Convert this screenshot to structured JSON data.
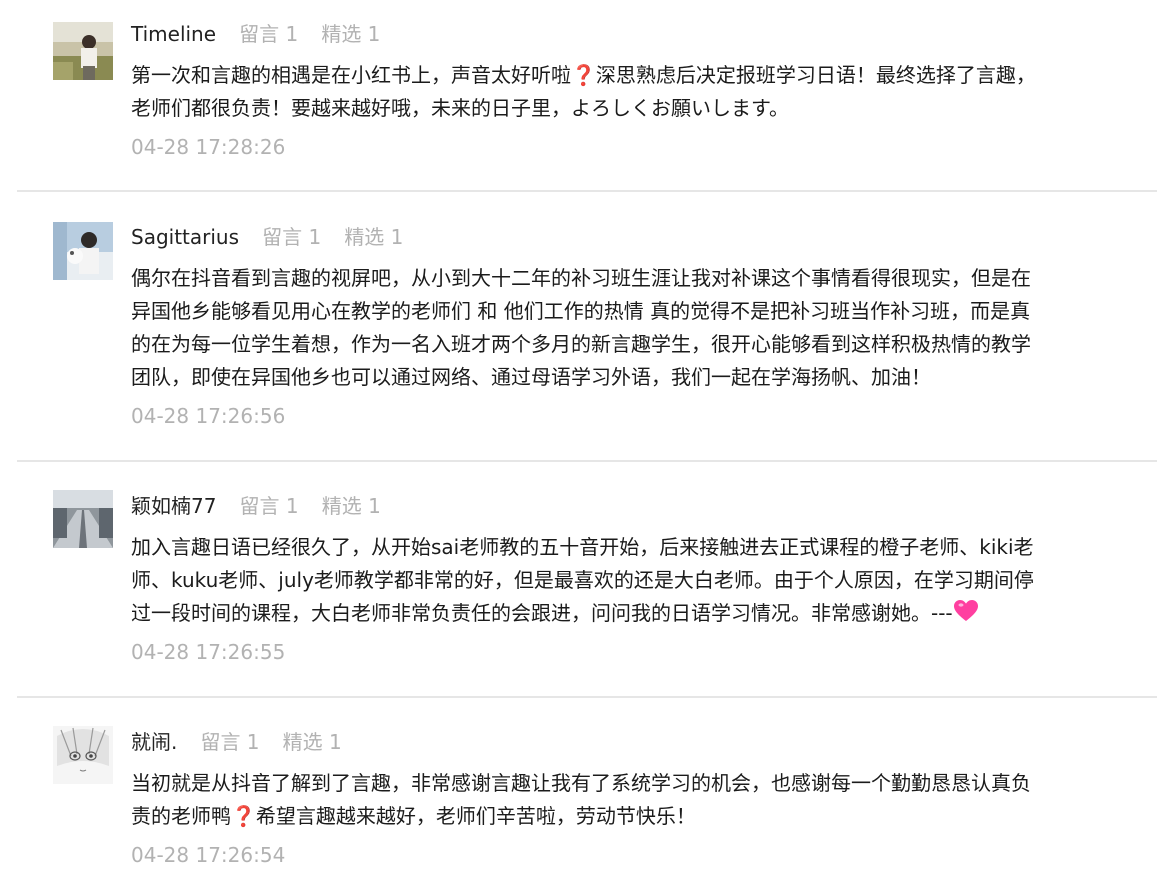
{
  "comments": [
    {
      "nickname": "Timeline",
      "replies_label": "留言 1",
      "featured_label": "精选 1",
      "lines": [
        "第一次和言趣的相遇是在小红书上，声音太好听啦❓深思熟虑后决定报班学习日语！最终选择了言趣，",
        "老师们都很负责！要越来越好哦，未来的日子里，よろしくお願いします。"
      ],
      "time": "04-28 17:28:26"
    },
    {
      "nickname": "Sagittarius",
      "replies_label": "留言 1",
      "featured_label": "精选 1",
      "lines": [
        "偶尔在抖音看到言趣的视屏吧，从小到大十二年的补习班生涯让我对补课这个事情看得很现实，但是在",
        "异国他乡能够看见用心在教学的老师们 和 他们工作的热情 真的觉得不是把补习班当作补习班，而是真",
        "的在为每一位学生着想，作为一名入班才两个多月的新言趣学生，很开心能够看到这样积极热情的教学",
        "团队，即使在异国他乡也可以通过网络、通过母语学习外语，我们一起在学海扬帆、加油！"
      ],
      "time": "04-28 17:26:56"
    },
    {
      "nickname": "颖如楠77",
      "replies_label": "留言 1",
      "featured_label": "精选 1",
      "lines": [
        "加入言趣日语已经很久了，从开始sai老师教的五十音开始，后来接触进去正式课程的橙子老师、kiki老",
        "师、kuku老师、july老师教学都非常的好，但是最喜欢的还是大白老师。由于个人原因，在学习期间停",
        "过一段时间的课程，大白老师非常负责任的会跟进，问问我的日语学习情况。非常感谢她。---"
      ],
      "time": "04-28 17:26:55"
    },
    {
      "nickname": "就闹.",
      "replies_label": "留言 1",
      "featured_label": "精选 1",
      "lines": [
        "当初就是从抖音了解到了言趣，非常感谢言趣让我有了系统学习的机会，也感谢每一个勤勤恳恳认真负",
        "责的老师鸭❓希望言趣越来越好，老师们辛苦啦，劳动节快乐！"
      ],
      "time": "04-28 17:26:54"
    }
  ],
  "icons": {
    "question_emoji": "red-question-mark-icon",
    "heart_emoji": "pink-heart-icon"
  },
  "colors": {
    "nickname": "#222222",
    "muted": "#b2b2b2",
    "text": "#1b1b1b",
    "divider": "#e6e6e6",
    "question": "#e0243a",
    "heart": "#ff3fa0"
  }
}
